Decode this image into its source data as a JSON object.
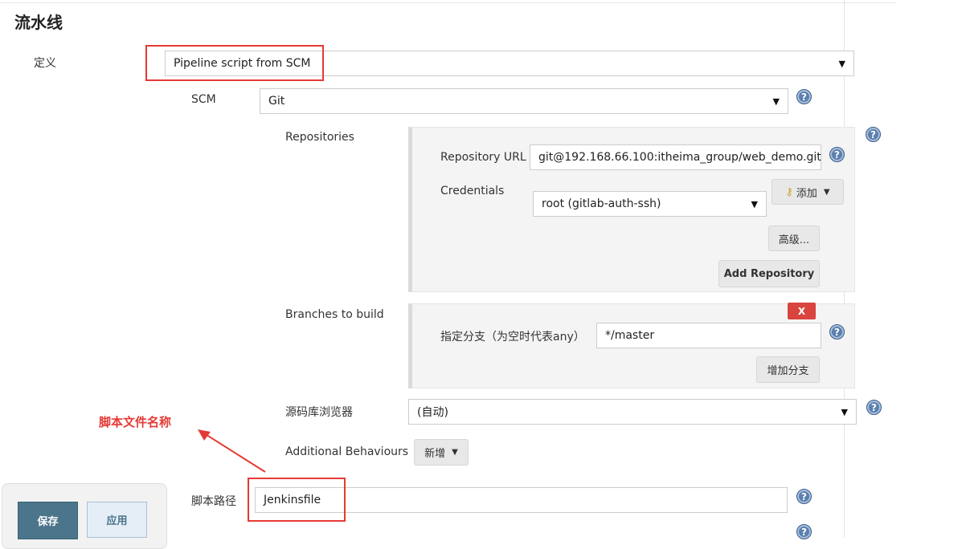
{
  "section": {
    "title": "流水线"
  },
  "definition": {
    "label": "定义",
    "value": "Pipeline script from SCM"
  },
  "scm": {
    "label": "SCM",
    "value": "Git"
  },
  "repositories": {
    "label": "Repositories",
    "url_label": "Repository URL",
    "url_value": "git@192.168.66.100:itheima_group/web_demo.git",
    "credentials_label": "Credentials",
    "credentials_value": "root (gitlab-auth-ssh)",
    "add_label": "添加",
    "advanced_label": "高级...",
    "add_repository_label": "Add Repository"
  },
  "branches": {
    "label": "Branches to build",
    "delete_label": "X",
    "specifier_label": "指定分支（为空时代表any）",
    "specifier_value": "*/master",
    "add_branch_label": "增加分支"
  },
  "browser": {
    "label": "源码库浏览器",
    "value": "(自动)"
  },
  "behaviours": {
    "label": "Additional Behaviours",
    "add_label": "新增"
  },
  "script_path": {
    "label": "脚本路径",
    "value": "Jenkinsfile"
  },
  "annotation": {
    "text": "脚本文件名称",
    "color": "#e53935"
  },
  "footer": {
    "save_label": "保存",
    "apply_label": "应用"
  },
  "colors": {
    "save": "#4b758b",
    "highlight": "#e53935",
    "help": "#5b7fae"
  }
}
